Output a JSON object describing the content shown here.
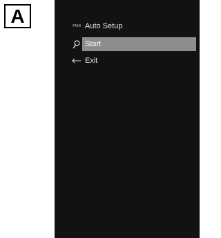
{
  "figure_label": "A",
  "menu": {
    "brand_icon": "YPAO",
    "title": "Auto Setup",
    "items": [
      {
        "label": "Start",
        "icon": "microphone-icon",
        "selected": true
      },
      {
        "label": "Exit",
        "icon": "return-arrow-icon",
        "selected": false
      }
    ]
  },
  "colors": {
    "screen_background": "#121212",
    "highlight": "#8d8d8d",
    "text": "#e6e6e6"
  }
}
